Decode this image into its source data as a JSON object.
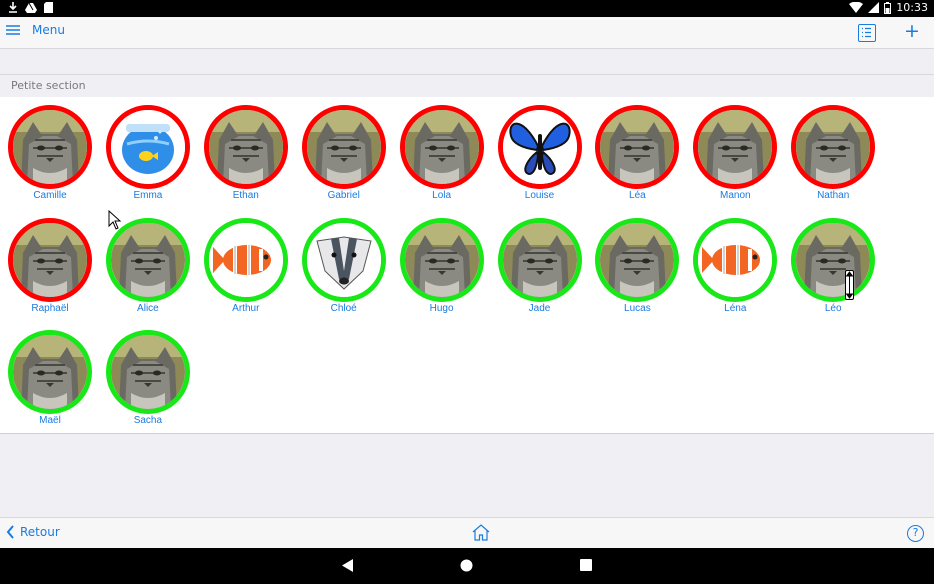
{
  "status": {
    "time": "10:33"
  },
  "header": {
    "menu_label": "Menu"
  },
  "section": {
    "title": "Petite section",
    "students": [
      {
        "name": "Camille",
        "status": "red",
        "avatar": "cat"
      },
      {
        "name": "Emma",
        "status": "red",
        "avatar": "fishbowl"
      },
      {
        "name": "Ethan",
        "status": "red",
        "avatar": "cat"
      },
      {
        "name": "Gabriel",
        "status": "red",
        "avatar": "cat"
      },
      {
        "name": "Lola",
        "status": "red",
        "avatar": "cat"
      },
      {
        "name": "Louise",
        "status": "red",
        "avatar": "butterfly"
      },
      {
        "name": "Léa",
        "status": "red",
        "avatar": "cat"
      },
      {
        "name": "Manon",
        "status": "red",
        "avatar": "cat"
      },
      {
        "name": "Nathan",
        "status": "red",
        "avatar": "cat"
      },
      {
        "name": "Raphaël",
        "status": "red",
        "avatar": "cat"
      },
      {
        "name": "Alice",
        "status": "green",
        "avatar": "cat"
      },
      {
        "name": "Arthur",
        "status": "green",
        "avatar": "clownfish"
      },
      {
        "name": "Chloé",
        "status": "green",
        "avatar": "badger"
      },
      {
        "name": "Hugo",
        "status": "green",
        "avatar": "cat"
      },
      {
        "name": "Jade",
        "status": "green",
        "avatar": "cat"
      },
      {
        "name": "Lucas",
        "status": "green",
        "avatar": "cat"
      },
      {
        "name": "Léna",
        "status": "green",
        "avatar": "clownfish"
      },
      {
        "name": "Léo",
        "status": "green",
        "avatar": "cat"
      },
      {
        "name": "Maël",
        "status": "green",
        "avatar": "cat"
      },
      {
        "name": "Sacha",
        "status": "green",
        "avatar": "cat"
      }
    ]
  },
  "footer": {
    "back_label": "Retour",
    "help_label": "?"
  },
  "colors": {
    "accent": "#1a7be0",
    "absent": "#ff0000",
    "present": "#18e818"
  }
}
